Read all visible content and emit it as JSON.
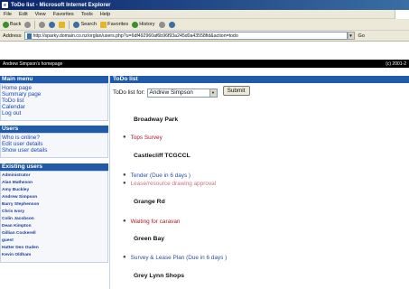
{
  "window": {
    "title": "ToDo list - Microsoft Internet Explorer"
  },
  "menu": [
    "File",
    "Edit",
    "View",
    "Favorites",
    "Tools",
    "Help"
  ],
  "toolbar": {
    "back": "Back",
    "search": "Search",
    "favorites": "Favorites",
    "history": "History"
  },
  "address": {
    "label": "Address",
    "url": "http://sparky.domain.co.nz/orglan/users.php?u=6df492960af6b96f93a245d0a43558fid&action=todo",
    "go": "Go"
  },
  "pagebar": {
    "left": "Andrew Simpson's homepage",
    "right": "(c) 2001-2"
  },
  "sidebar": {
    "main_menu": {
      "title": "Main menu",
      "items": [
        "Home page",
        "Summary page",
        "ToDo list",
        "Calendar",
        "Log out"
      ]
    },
    "users": {
      "title": "Users",
      "items": [
        "Who is online?",
        "Edit user details",
        "Show user details"
      ]
    },
    "existing_users": {
      "title": "Existing users",
      "items": [
        "Administrator",
        "Alan Matheson",
        "Amy Buckley",
        "Andrew Simpson",
        "Barry Stephenson",
        "Chris Ivory",
        "Colin Jacobson",
        "Dean Kimpton",
        "Gillian Cockerell",
        "guest",
        "Hatter Den Ouden",
        "Kevin Oldham"
      ]
    }
  },
  "main": {
    "title": "ToDo list",
    "filter_label": "ToDo list for:",
    "selected_user": "Andrew Simpson",
    "submit": "Submit",
    "sites": [
      {
        "name": "Broadway Park",
        "items": [
          {
            "text": "Tops Survey",
            "color": "red"
          }
        ]
      },
      {
        "name": "Castlecliff TCGCCL",
        "items": [
          {
            "text": "Tender (Due in 6 days )",
            "color": "blue"
          },
          {
            "text": "Lease/resource drawing approval",
            "color": "faded"
          }
        ]
      },
      {
        "name": "Grange Rd",
        "items": [
          {
            "text": "Waiting for caravan",
            "color": "red"
          }
        ]
      },
      {
        "name": "Green Bay",
        "items": [
          {
            "text": "Survey & Lease Plan (Due in 6 days )",
            "color": "blue"
          }
        ]
      },
      {
        "name": "Grey Lynn Shops",
        "items": []
      }
    ]
  },
  "colors": {
    "accent_blue": "#1f5ba8",
    "link_blue": "#1b48b5",
    "todo_red": "#b3172a"
  }
}
